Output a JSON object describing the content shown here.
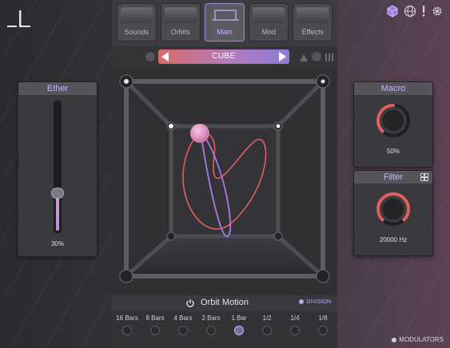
{
  "tabs": [
    {
      "label": "Sounds",
      "active": false
    },
    {
      "label": "Orbits",
      "active": false
    },
    {
      "label": "Main",
      "active": true
    },
    {
      "label": "Mod",
      "active": false
    },
    {
      "label": "Effects",
      "active": false
    }
  ],
  "preset": {
    "name": "CUBE"
  },
  "ether": {
    "title": "Ether",
    "value": "30%",
    "level": 0.3
  },
  "macro": {
    "title": "Macro",
    "value": "50%",
    "level": 0.5
  },
  "filter": {
    "title": "Filter",
    "value": "20000 Hz",
    "level": 1.0
  },
  "orbit_motion": {
    "title": "Orbit Motion",
    "division_label": "DIVISION",
    "rates": [
      {
        "label": "16 Bars"
      },
      {
        "label": "8 Bars"
      },
      {
        "label": "4 Bars"
      },
      {
        "label": "2 Bars"
      },
      {
        "label": "1 Bar",
        "active": true
      },
      {
        "label": "1/2"
      },
      {
        "label": "1/4"
      },
      {
        "label": "1/8"
      }
    ]
  },
  "footer": {
    "modulators_label": "MODULATORS"
  },
  "colors": {
    "accent": "#b9a6ff",
    "orbit_red": "#e0605f",
    "orbit_purple": "#a77be0",
    "ball": "#e8a3c9"
  },
  "icons": [
    "logo-icon",
    "cube-icon",
    "globe-icon",
    "alert-icon",
    "gear-icon",
    "power-icon",
    "grid-icon"
  ]
}
